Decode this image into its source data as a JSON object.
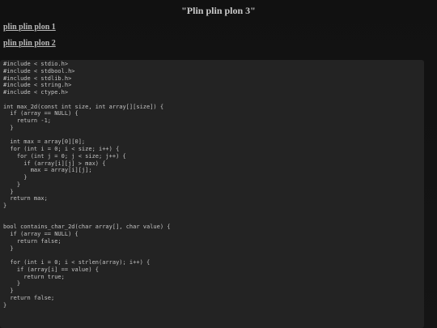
{
  "header": {
    "title": "\"Plin plin plon 3\""
  },
  "nav": {
    "links": [
      {
        "label": "plin plin plon 1"
      },
      {
        "label": "plin plin plon 2"
      }
    ]
  },
  "code": {
    "content": "#include < stdio.h>\n#include < stdbool.h>\n#include < stdlib.h>\n#include < string.h>\n#include < ctype.h>\n\nint max_2d(const int size, int array[][size]) {\n  if (array == NULL) {\n    return -1;\n  }\n\n  int max = array[0][0];\n  for (int i = 0; i < size; i++) {\n    for (int j = 0; j < size; j++) {\n      if (array[i][j] > max) {\n        max = array[i][j];\n      }\n    }\n  }\n  return max;\n}\n\n\nbool contains_char_2d(char array[], char value) {\n  if (array == NULL) {\n    return false;\n  }\n\n  for (int i = 0; i < strlen(array); i++) {\n    if (array[i] == value) {\n      return true;\n    }\n  }\n  return false;\n}"
  }
}
